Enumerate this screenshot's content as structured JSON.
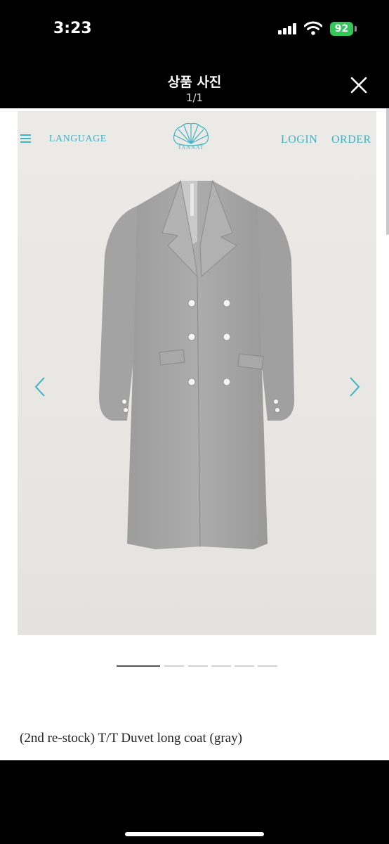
{
  "status_bar": {
    "time": "3:23",
    "battery_level": "92",
    "icons": [
      "signal-icon",
      "wifi-icon",
      "battery-icon"
    ]
  },
  "viewer": {
    "title": "상품 사진",
    "counter": "1/1",
    "close_icon": "close-icon"
  },
  "site_nav": {
    "menu_icon": "hamburger-menu-icon",
    "language": "LANGUAGE",
    "brand": "TANNAT",
    "login": "LOGIN",
    "order": "ORDER",
    "accent_color": "#3db3c5"
  },
  "carousel": {
    "prev_icon": "chevron-left-icon",
    "next_icon": "chevron-right-icon",
    "pages": 6,
    "active_page": 1
  },
  "product": {
    "title": "(2nd re-stock) T/T Duvet long coat (gray)"
  }
}
